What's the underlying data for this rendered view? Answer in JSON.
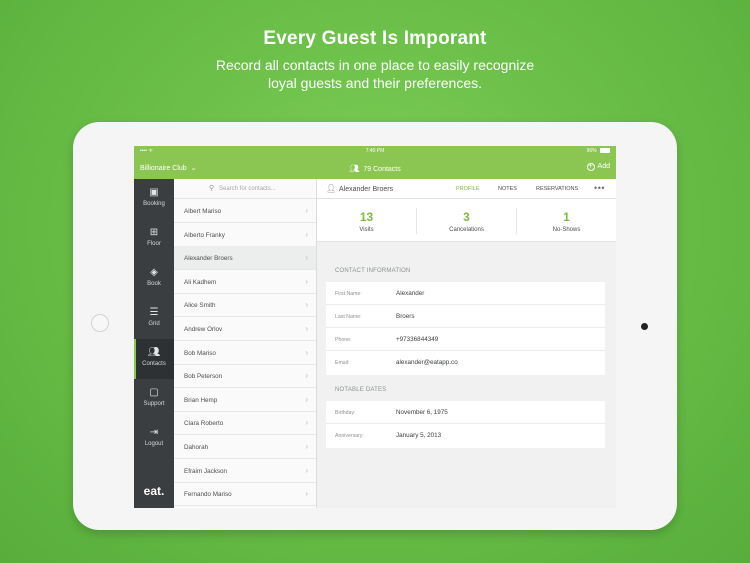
{
  "marketing": {
    "headline": "Every Guest Is Imporant",
    "subline_1": "Record all contacts in one place to easily recognize",
    "subline_2": "loyal guests and their preferences."
  },
  "statusbar": {
    "carrier": "•••• ᯤ",
    "time": "7:40 PM",
    "battery": "96%",
    "battery_level": 0.96
  },
  "appbar": {
    "venue": "Billionaire Club",
    "contacts_count": "79 Contacts",
    "add_label": "Add"
  },
  "sidebar": {
    "items": [
      {
        "label": "Booking",
        "icon": "calendar-icon"
      },
      {
        "label": "Floor",
        "icon": "grid-squares-icon"
      },
      {
        "label": "Book",
        "icon": "book-icon"
      },
      {
        "label": "Grid",
        "icon": "list-lines-icon"
      },
      {
        "label": "Contacts",
        "icon": "people-icon"
      },
      {
        "label": "Support",
        "icon": "chat-bubble-icon"
      },
      {
        "label": "Logout",
        "icon": "logout-icon"
      }
    ],
    "active": "Contacts",
    "logo": "eat."
  },
  "contact_list": {
    "search_placeholder": "Search for contacts...",
    "items": [
      "Albert Mariso",
      "Alberto Franky",
      "Alexander Broers",
      "Ali Kadhem",
      "Alice Smith",
      "Andrew Orlov",
      "Bob Mariso",
      "Bob Peterson",
      "Brian Hemp",
      "Clara Roberto",
      "Dahorah",
      "Efraim Jackson",
      "Fernando Mariso"
    ],
    "selected": "Alexander Broers"
  },
  "detail": {
    "name": "Alexander Broers",
    "tabs": [
      "PROFILE",
      "NOTES",
      "RESERVATIONS"
    ],
    "active_tab": "PROFILE",
    "more": "•••",
    "stats": [
      {
        "value": "13",
        "label": "Visits"
      },
      {
        "value": "3",
        "label": "Cancelations"
      },
      {
        "value": "1",
        "label": "No-Shows"
      }
    ],
    "contact_info_title": "CONTACT INFORMATION",
    "contact_info": [
      {
        "key": "First Name:",
        "value": "Alexander"
      },
      {
        "key": "Last Name:",
        "value": "Broers"
      },
      {
        "key": "Phone:",
        "value": "+97336844349"
      },
      {
        "key": "Email:",
        "value": "alexander@eatapp.co"
      }
    ],
    "notable_dates_title": "NOTABLE DATES",
    "notable_dates": [
      {
        "key": "Birthday:",
        "value": "November 6, 1975"
      },
      {
        "key": "Anniversary:",
        "value": "January 5, 2013"
      }
    ]
  },
  "colors": {
    "background_green": "#6cc04a",
    "app_green": "#8cc652",
    "accent_green": "#7dbb42",
    "sidebar_dark": "#3b3e40"
  }
}
